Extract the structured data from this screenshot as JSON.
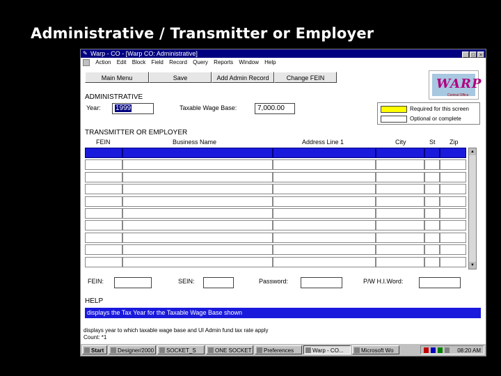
{
  "slide_title": "Administrative / Transmitter or Employer",
  "window": {
    "title": "Warp - CO - [Warp CO: Administrative]",
    "controls": [
      "_",
      "□",
      "×"
    ]
  },
  "menu": [
    "Action",
    "Edit",
    "Block",
    "Field",
    "Record",
    "Query",
    "Reports",
    "Window",
    "Help"
  ],
  "toolbar": {
    "main_menu": "Main Menu",
    "save": "Save",
    "add_admin": "Add Admin Record",
    "change_fein": "Change FEIN"
  },
  "logo": {
    "word": "WARP",
    "sub": "Central Office"
  },
  "administrative": {
    "heading": "ADMINISTRATIVE",
    "year_label": "Year:",
    "year_value": "1999",
    "wage_label": "Taxable Wage Base:",
    "wage_value": "7,000.00"
  },
  "legend": {
    "required": "Required for this screen",
    "optional": "Optional or complete",
    "required_color": "#ffff00",
    "optional_color": "#ffffff"
  },
  "transmitter": {
    "heading": "TRANSMITTER OR EMPLOYER",
    "columns": [
      "FEIN",
      "Business Name",
      "Address Line 1",
      "City",
      "St",
      "Zip"
    ]
  },
  "search": {
    "fein_label": "FEIN:",
    "sein_label": "SEIN:",
    "password_label": "Password:",
    "pwh_label": "P/W H.I.Word:"
  },
  "help": {
    "heading": "HELP",
    "text": "displays the Tax Year for the Taxable Wage Base shown"
  },
  "status": {
    "line1": "displays year to which taxable wage base and UI Admin fund tax rate apply",
    "line2": "Count: *1"
  },
  "taskbar": {
    "start": "Start",
    "items": [
      "Designer/2000",
      "SOCKET_S",
      "ONE SOCKET",
      "Preferences",
      "Warp - CO...",
      "Microsoft Wo"
    ],
    "clock": "08:20 AM"
  },
  "colors": {
    "titlebar": "#000080",
    "selection": "#1a1adc"
  }
}
